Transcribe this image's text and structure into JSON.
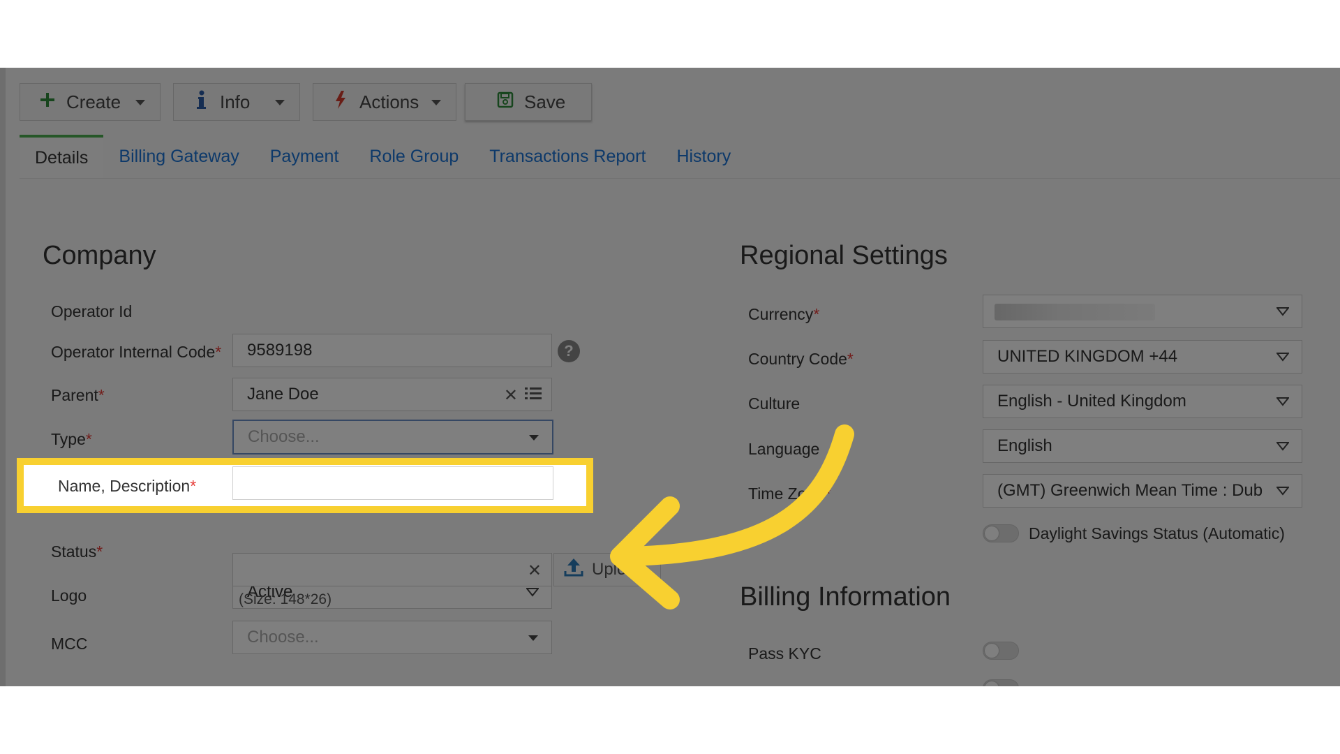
{
  "toolbar": {
    "create_label": "Create",
    "info_label": "Info",
    "actions_label": "Actions",
    "save_label": "Save"
  },
  "tabs": [
    {
      "label": "Details",
      "active": true
    },
    {
      "label": "Billing Gateway"
    },
    {
      "label": "Payment"
    },
    {
      "label": "Role Group"
    },
    {
      "label": "Transactions Report"
    },
    {
      "label": "History"
    }
  ],
  "company": {
    "title": "Company",
    "operator_id_label": "Operator Id",
    "operator_internal_code_label": "Operator Internal Code",
    "operator_internal_code_value": "9589198",
    "parent_label": "Parent",
    "parent_value": "Jane Doe",
    "type_label": "Type",
    "type_placeholder": "Choose...",
    "name_label": "Name, Description",
    "name_value": "",
    "status_label": "Status",
    "status_value": "Active",
    "logo_label": "Logo",
    "upload_label": "Upload",
    "logo_size_hint": "(Size: 148*26)",
    "mcc_label": "MCC",
    "mcc_placeholder": "Choose..."
  },
  "regional": {
    "title": "Regional Settings",
    "currency_label": "Currency",
    "currency_value": "",
    "country_code_label": "Country Code",
    "country_code_value": "UNITED KINGDOM +44",
    "culture_label": "Culture",
    "culture_value": "English - United Kingdom",
    "language_label": "Language",
    "language_value": "English",
    "timezone_label": "Time Zone",
    "timezone_value": "(GMT) Greenwich Mean Time : Dub",
    "dst_label": "Daylight Savings Status (Automatic)"
  },
  "billing": {
    "title": "Billing Information",
    "pass_kyc_label": "Pass KYC"
  },
  "colors": {
    "highlight": "#f8d030",
    "arrow": "#f8d030",
    "tab_link": "#1a73d4",
    "active_tab_border": "#4caf50",
    "required": "#e53935"
  },
  "icons": {
    "create": "plus-icon",
    "info": "info-icon",
    "actions": "lightning-icon",
    "save": "floppy-disk-icon",
    "upload": "upload-icon",
    "help": "question-circle-icon"
  }
}
